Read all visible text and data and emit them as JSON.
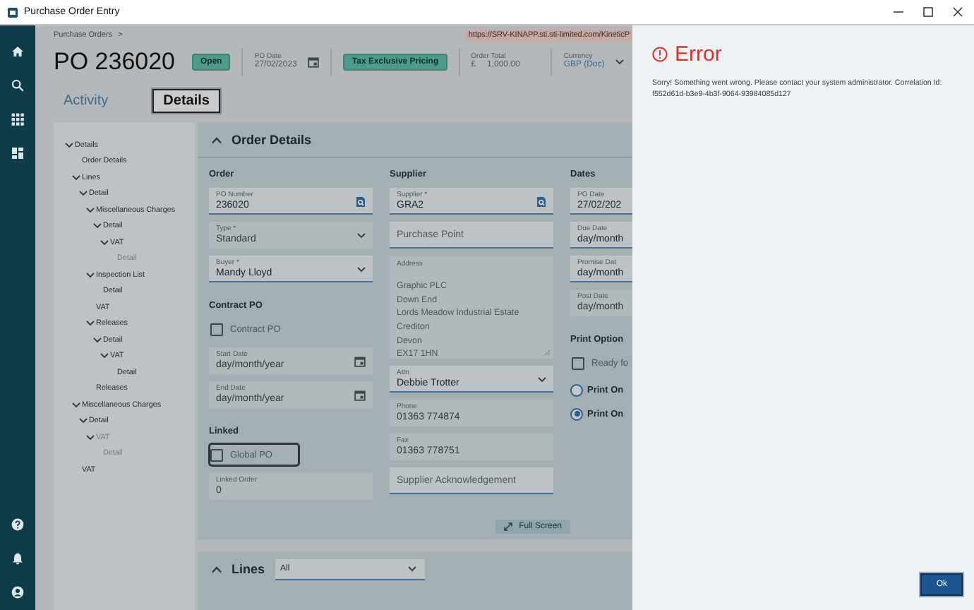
{
  "window": {
    "title": "Purchase Order Entry"
  },
  "breadcrumb": {
    "items": [
      "Purchase Orders"
    ],
    "separator": ">"
  },
  "url": "https://SRV-KINAPP.sti.sti-limited.com/KineticP",
  "header": {
    "title": "PO 236020",
    "status": "Open",
    "po_date": {
      "label": "PO Date",
      "value": "27/02/2023"
    },
    "pricing": "Tax Exclusive Pricing",
    "order_total": {
      "label": "Order Total",
      "symbol": "£",
      "value": "1,000.00"
    },
    "currency": {
      "label": "Currency",
      "value": "GBP (Doc)"
    }
  },
  "tabs": [
    {
      "label": "Activity",
      "selected": false
    },
    {
      "label": "Details",
      "selected": true
    }
  ],
  "tree": [
    {
      "label": "Details",
      "disabled": false,
      "expanded": true,
      "children": [
        {
          "label": "Order Details",
          "disabled": false
        },
        {
          "label": "Lines",
          "disabled": false,
          "expanded": true,
          "children": [
            {
              "label": "Detail",
              "disabled": false,
              "expanded": true,
              "children": [
                {
                  "label": "Miscellaneous Charges",
                  "disabled": false,
                  "expanded": true,
                  "children": [
                    {
                      "label": "Detail",
                      "disabled": false,
                      "expanded": true,
                      "children": [
                        {
                          "label": "VAT",
                          "disabled": false,
                          "expanded": true,
                          "children": [
                            {
                              "label": "Detail",
                              "disabled": true
                            }
                          ]
                        }
                      ]
                    }
                  ]
                },
                {
                  "label": "Inspection List",
                  "disabled": false,
                  "expanded": true,
                  "children": [
                    {
                      "label": "Detail",
                      "disabled": false
                    }
                  ]
                },
                {
                  "label": "VAT",
                  "disabled": false
                },
                {
                  "label": "Releases",
                  "disabled": false,
                  "expanded": true,
                  "children": [
                    {
                      "label": "Detail",
                      "disabled": false,
                      "expanded": true,
                      "children": [
                        {
                          "label": "VAT",
                          "disabled": false,
                          "expanded": true,
                          "children": [
                            {
                              "label": "Detail",
                              "disabled": false
                            }
                          ]
                        }
                      ]
                    }
                  ]
                },
                {
                  "label": "Releases",
                  "disabled": false
                }
              ]
            }
          ]
        },
        {
          "label": "Miscellaneous Charges",
          "disabled": false,
          "expanded": true,
          "children": [
            {
              "label": "Detail",
              "disabled": false,
              "expanded": true,
              "children": [
                {
                  "label": "VAT",
                  "disabled": true,
                  "expanded": true,
                  "children": [
                    {
                      "label": "Detail",
                      "disabled": true
                    }
                  ]
                }
              ]
            }
          ]
        },
        {
          "label": "VAT",
          "disabled": false
        }
      ]
    }
  ],
  "order_details": {
    "title": "Order Details",
    "columns": [
      {
        "title": "Order",
        "items": [
          {
            "kind": "lookup_field",
            "label": "PO Number",
            "value": "236020",
            "disabled": false
          },
          {
            "kind": "select_field",
            "label": "Type *",
            "value": "Standard",
            "disabled": true
          },
          {
            "kind": "select_field",
            "label": "Buyer *",
            "value": "Mandy Lloyd",
            "disabled": false
          },
          {
            "kind": "heading",
            "label": "Contract PO"
          },
          {
            "kind": "checkbox",
            "label": "Contract PO",
            "checked": false,
            "focused": false
          },
          {
            "kind": "date_field",
            "label": "Start Date",
            "value": "day/month/year",
            "disabled": true
          },
          {
            "kind": "date_field",
            "label": "End Date",
            "value": "day/month/year",
            "disabled": true
          },
          {
            "kind": "heading",
            "label": "Linked"
          },
          {
            "kind": "checkbox",
            "label": "Global PO",
            "checked": false,
            "focused": true
          },
          {
            "kind": "field",
            "label": "Linked Order",
            "value": "0",
            "disabled": true
          }
        ]
      },
      {
        "title": "Supplier",
        "items": [
          {
            "kind": "lookup_field",
            "label": "Supplier *",
            "value": "GRA2",
            "disabled": false
          },
          {
            "kind": "field",
            "placeholder": "Purchase Point",
            "disabled": false
          },
          {
            "kind": "textarea",
            "label": "Address",
            "lines": [
              "Graphic PLC",
              "Down End",
              "Lords Meadow Industrial Estate",
              "Crediton",
              "Devon",
              "EX17 1HN"
            ],
            "disabled": true
          },
          {
            "kind": "select_field",
            "label": "Attn",
            "value": "Debbie Trotter",
            "disabled": false
          },
          {
            "kind": "field",
            "label": "Phone",
            "value": "01363 774874",
            "disabled": true
          },
          {
            "kind": "field",
            "label": "Fax",
            "value": "01363 778751",
            "disabled": true
          },
          {
            "kind": "field",
            "placeholder": "Supplier Acknowledgement",
            "disabled": false
          }
        ]
      },
      {
        "title": "Dates",
        "items": [
          {
            "kind": "field",
            "label": "PO Date",
            "value": "27/02/202",
            "disabled": false
          },
          {
            "kind": "field",
            "label": "Due Date",
            "value": "day/month",
            "disabled": false
          },
          {
            "kind": "field",
            "label": "Promise Dat",
            "value": "day/month",
            "disabled": false
          },
          {
            "kind": "field",
            "label": "Post Date",
            "value": "day/month",
            "disabled": true
          },
          {
            "kind": "heading",
            "label": "Print Option"
          },
          {
            "kind": "checkbox",
            "label": "Ready fo",
            "checked": false,
            "focused": false
          },
          {
            "kind": "radio",
            "label": "Print On",
            "selected": false
          },
          {
            "kind": "radio",
            "label": "Print On",
            "selected": true
          }
        ]
      }
    ]
  },
  "full_screen_button": "Full Screen",
  "lines_section": {
    "title": "Lines",
    "filter": "All"
  },
  "error_panel": {
    "title": "Error",
    "message": "Sorry! Something went wrong. Please contact your system administrator. Correlation Id: f552d61d-b3e9-4b3f-9064-93984085d127",
    "button": "Ok"
  }
}
